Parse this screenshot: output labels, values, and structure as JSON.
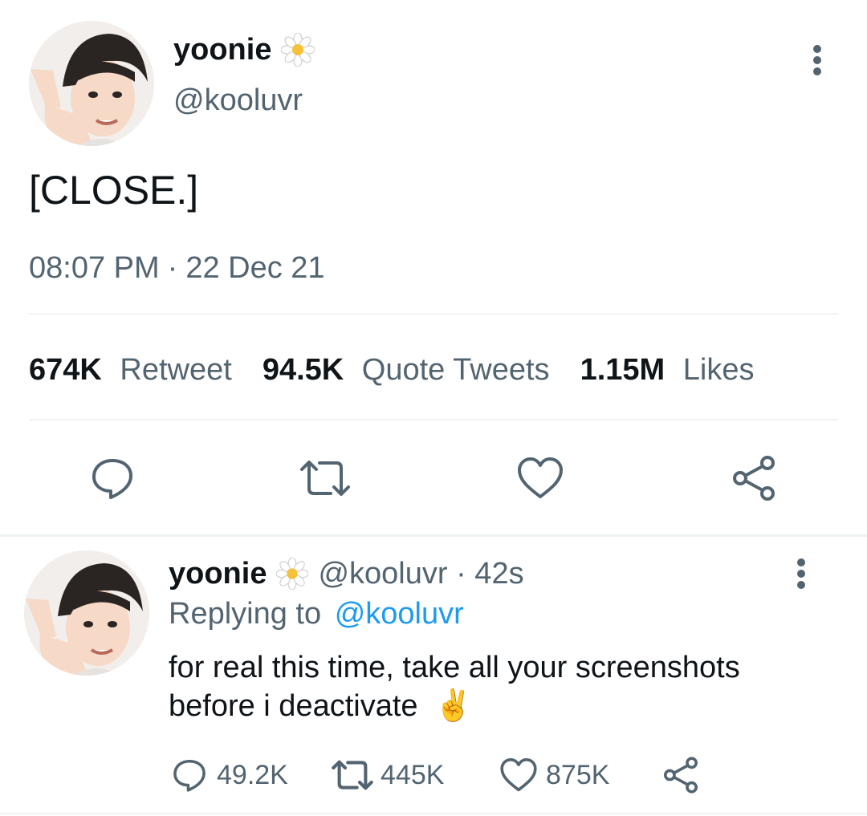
{
  "main_tweet": {
    "display_name": "yoonie",
    "name_emoji": "daisy-flower-icon",
    "handle": "@kooluvr",
    "text": "[CLOSE.]",
    "time": "08:07 PM",
    "separator": "·",
    "date": "22 Dec 21",
    "stats": {
      "retweets_count": "674K",
      "retweets_label": "Retweet",
      "quotes_count": "94.5K",
      "quotes_label": "Quote Tweets",
      "likes_count": "1.15M",
      "likes_label": "Likes"
    },
    "actions": [
      "reply-icon",
      "retweet-icon",
      "like-icon",
      "share-icon"
    ]
  },
  "reply_tweet": {
    "display_name": "yoonie",
    "handle_time": "@kooluvr · 42s",
    "replying_label": "Replying to",
    "replying_to": "@kooluvr",
    "text": "for real this time, take all your screenshots before i deactivate",
    "text_emoji": "✌",
    "reply_count": "49.2K",
    "retweet_count": "445K",
    "like_count": "875K"
  },
  "colors": {
    "accent": "#1d9bf0",
    "muted": "#536471",
    "divider": "#eff3f4",
    "emoji": "#f5c03a"
  }
}
